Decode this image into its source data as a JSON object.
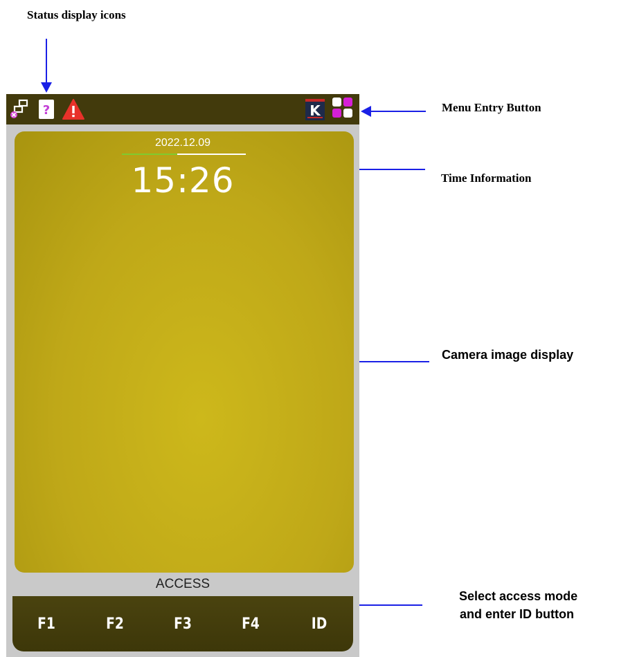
{
  "annotations": {
    "status_icons": "Status display icons",
    "menu_entry": "Menu Entry Button",
    "time_info": "Time Information",
    "camera_display": "Camera image display",
    "select_mode_line1": "Select access mode",
    "select_mode_line2": "and enter ID button"
  },
  "device": {
    "date": "2022.12.09",
    "time": "15:26",
    "mode_label": "ACCESS",
    "logo_letter": "K",
    "function_buttons": [
      "F1",
      "F2",
      "F3",
      "F4",
      "ID"
    ],
    "status_icons": [
      "network-disconnected-icon",
      "help-question-icon",
      "warning-icon"
    ],
    "colors": {
      "status_bar": "#423a0c",
      "camera": "#c2ab18",
      "frame": "#c9c9c9",
      "arrow": "#1a20e6",
      "warning": "#e8312a",
      "menu_magenta": "#d61fd6"
    }
  }
}
